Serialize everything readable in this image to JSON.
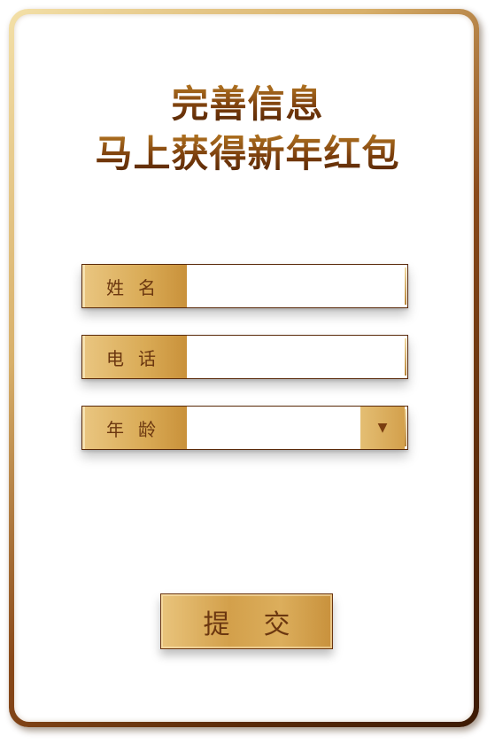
{
  "title": {
    "line1": "完善信息",
    "line2": "马上获得新年红包"
  },
  "form": {
    "name": {
      "label": "姓名",
      "value": "",
      "placeholder": ""
    },
    "phone": {
      "label": "电话",
      "value": "",
      "placeholder": ""
    },
    "age": {
      "label": "年龄",
      "selected": "",
      "dropdown_icon": "▼"
    }
  },
  "submit_label": "提交",
  "colors": {
    "gold_light": "#e9c57f",
    "gold": "#d3a04c",
    "brown_dark": "#5a2a08",
    "title_brown": "#6e3508"
  }
}
